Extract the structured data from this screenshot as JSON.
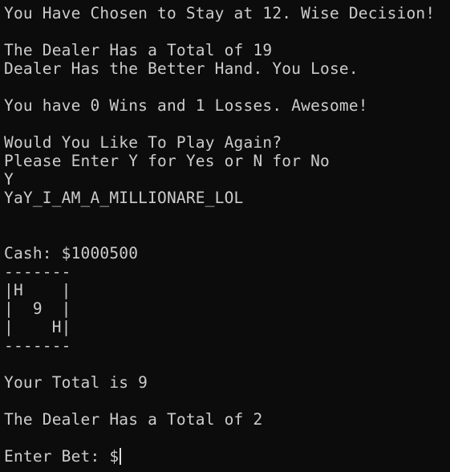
{
  "terminal": {
    "lines": [
      "You Have Chosen to Stay at 12. Wise Decision!",
      "",
      "The Dealer Has a Total of 19",
      "Dealer Has the Better Hand. You Lose.",
      "",
      "You have 0 Wins and 1 Losses. Awesome!",
      "",
      "Would You Like To Play Again?",
      "Please Enter Y for Yes or N for No",
      "Y",
      "YaY_I_AM_A_MILLIONARE_LOL",
      "",
      "",
      "Cash: $1000500",
      "-------",
      "|H    |",
      "|  9  |",
      "|    H|",
      "-------",
      "",
      "Your Total is 9",
      "",
      "The Dealer Has a Total of 2",
      "",
      "Enter Bet: $"
    ]
  }
}
